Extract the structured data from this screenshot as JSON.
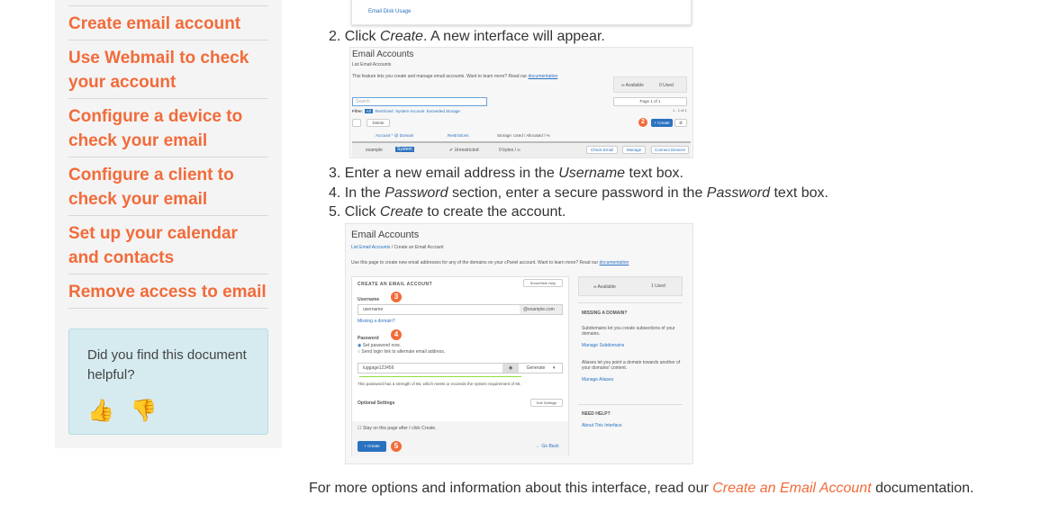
{
  "sidebar": {
    "links": [
      "Create email account",
      "Use Webmail to check your account",
      "Configure a device to check your email",
      "Configure a client to check your email",
      "Set up your calendar and contacts",
      "Remove access to email"
    ],
    "feedback": {
      "question": "Did you find this document helpful?",
      "thumbs_up": "thumbs-up-icon",
      "thumbs_down": "thumbs-down-icon"
    }
  },
  "shot0": {
    "label": "Email Disk Usage"
  },
  "steps": {
    "s2": {
      "num": "2. Click ",
      "em": "Create",
      "rest": ". A new interface will appear."
    },
    "s3": {
      "num": "3. Enter a new email address in the ",
      "em": "Username",
      "rest": " text box."
    },
    "s4": {
      "num": "4. In the ",
      "em": "Password",
      "mid": " section, enter a secure password in the ",
      "em2": "Password",
      "rest": " text box."
    },
    "s5": {
      "num": "5. Click ",
      "em": "Create",
      "rest": " to create the account."
    }
  },
  "shot1": {
    "title": "Email Accounts",
    "subtitle": "List Email Accounts",
    "desc": "This feature lets you create and manage email accounts. Want to learn more? Read our",
    "doc": "documentation",
    "available": "∞ Available",
    "used": "0 Used",
    "search": "Search",
    "pager": "Page 1 of 1",
    "count": "1 - 1 of 1",
    "filter": "Filter:",
    "filters": [
      "All",
      "Restricted",
      "System Account",
      "Exceeded Storage"
    ],
    "delete": "Delete",
    "create": "+ Create",
    "badge": "2",
    "cols": [
      "Account ^ @ Domain",
      "Restrictions",
      "Storage: Used / Allocated / %"
    ],
    "row": {
      "account": "example",
      "tag": "System",
      "restriction": "✔ Unrestricted",
      "storage": "0 bytes / ∞",
      "actions": [
        "Check Email",
        "Manage",
        "Connect Devices"
      ]
    }
  },
  "shot2": {
    "title": "Email Accounts",
    "crumb_link": "List Email Accounts",
    "crumb": "/  Create an Email Account",
    "desc": "Use this page to create new email addresses for any of the domains on your cPanel account. Want to learn more? Read our",
    "doc": "documentation",
    "panel_title": "CREATE AN EMAIL ACCOUNT",
    "help": "Show/Hide Help",
    "username_label": "Username",
    "username": "username",
    "domain": "@example.com",
    "missing": "Missing a domain?",
    "password_label": "Password",
    "opt1": "Set password now.",
    "opt2": "Send login link to alternate email address.",
    "password": "luggage123456",
    "generate": "Generate",
    "strength": "This password has a strength of 66, which meets or exceeds the system requirement of 65.",
    "optional": "Optional Settings",
    "edit": "Edit Settings",
    "stay": "Stay on this page after I click Create.",
    "create": "+ Create",
    "goback": "← Go Back",
    "badges": [
      "3",
      "4",
      "5"
    ],
    "available": "∞ Available",
    "used": "1 Used",
    "missing_title": "MISSING A DOMAIN?",
    "sub_text": "Subdomains let you create subsections of your domains.",
    "manage_sub": "Manage Subdomains",
    "alias_text": "Aliases let you point a domain towards another of your domains' content.",
    "manage_alias": "Manage Aliases",
    "need_help": "NEED HELP?",
    "about": "About This Interface"
  },
  "footer": {
    "pre": "For more options and information about this interface, read our ",
    "link": "Create an Email Account",
    "post": " documentation."
  }
}
